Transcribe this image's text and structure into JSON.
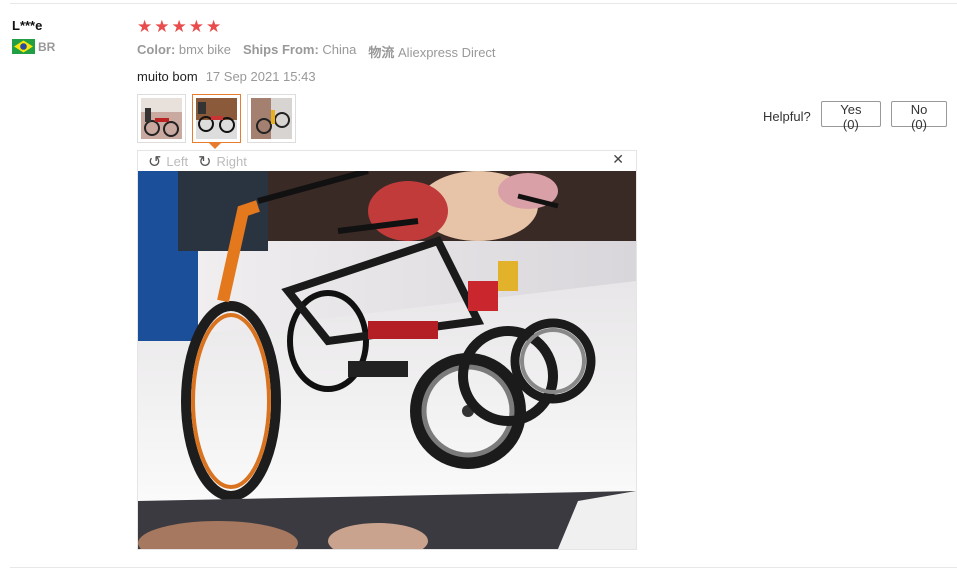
{
  "buyer": {
    "name": "L***e",
    "country": "BR",
    "flag_icon": "brazil-flag-icon"
  },
  "rating": {
    "stars": 5,
    "max": 5,
    "color": "#e84c4c"
  },
  "attributes": [
    {
      "key": "Color:",
      "value": "bmx bike"
    },
    {
      "key": "Ships From:",
      "value": "China"
    },
    {
      "key": "物流",
      "value": "Aliexpress Direct"
    }
  ],
  "review": {
    "text": "muito bom",
    "date": "17 Sep 2021 15:43"
  },
  "thumbnails": {
    "count": 3,
    "active_index": 1,
    "active_color": "#e97b2c"
  },
  "viewer": {
    "rotate_left_label": "Left",
    "rotate_right_label": "Right",
    "rotate_left_icon": "rotate-left-icon",
    "rotate_right_icon": "rotate-right-icon",
    "close_icon": "close-icon"
  },
  "helpful": {
    "label": "Helpful?",
    "yes_label": "Yes (0)",
    "no_label": "No (0)"
  }
}
